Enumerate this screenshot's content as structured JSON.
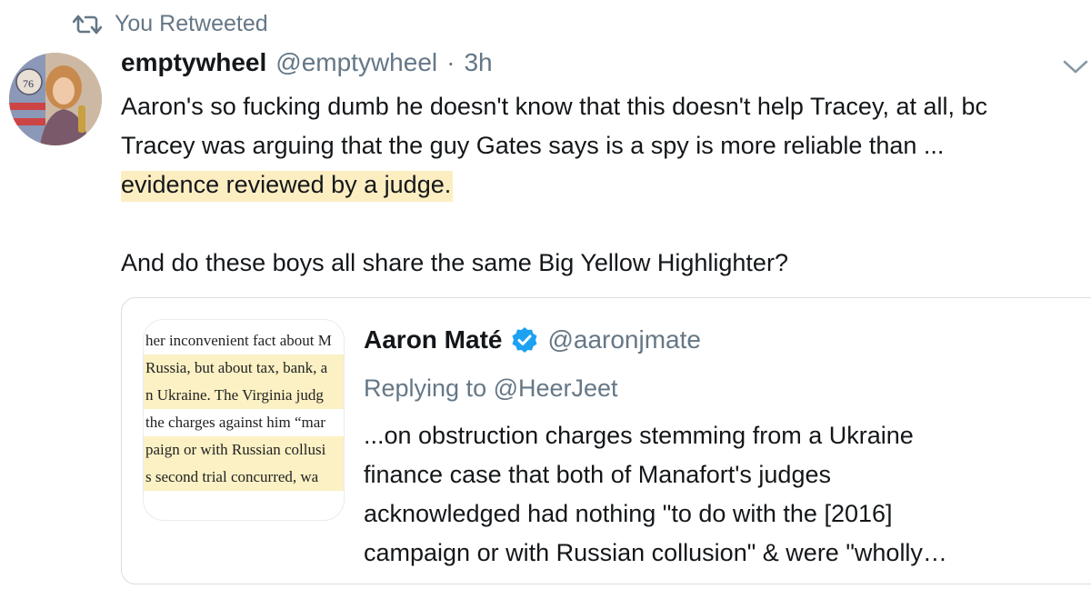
{
  "retweet": {
    "icon": "retweet-icon",
    "label": "You Retweeted",
    "color": "#657786"
  },
  "tweet": {
    "avatar_icon": "avatar",
    "display_name": "emptywheel",
    "handle": "@emptywheel",
    "separator": "·",
    "time": "3h",
    "menu_icon": "chevron-down-icon",
    "text_lines": [
      "Aaron's so fucking dumb he doesn't know that this doesn't help Tracey, at all, bc",
      "Tracey was arguing that the guy Gates says is a spy is more reliable than ...",
      "evidence reviewed by a judge."
    ],
    "text_line_4": "And do these boys all share the same Big Yellow Highlighter?",
    "highlight_color": "#fdeec2"
  },
  "quote": {
    "thumbnail_lines": [
      "her inconvenient fact about M",
      "Russia, but about tax, bank, a",
      "n Ukraine. The Virginia judg",
      "the charges against him “mar",
      "paign or with Russian collusi",
      "s second trial concurred, wa"
    ],
    "display_name": "Aaron Maté",
    "verified_icon": "verified-badge-icon",
    "handle": "@aaronjmate",
    "replying": "Replying to @HeerJeet",
    "text_lines": [
      "...on obstruction charges stemming from a Ukraine",
      "finance case that both of Manafort's judges",
      "acknowledged had nothing \"to do with the [2016]",
      "campaign or with Russian collusion\" & were \"wholly…"
    ],
    "verified_color": "#1da1f2"
  }
}
